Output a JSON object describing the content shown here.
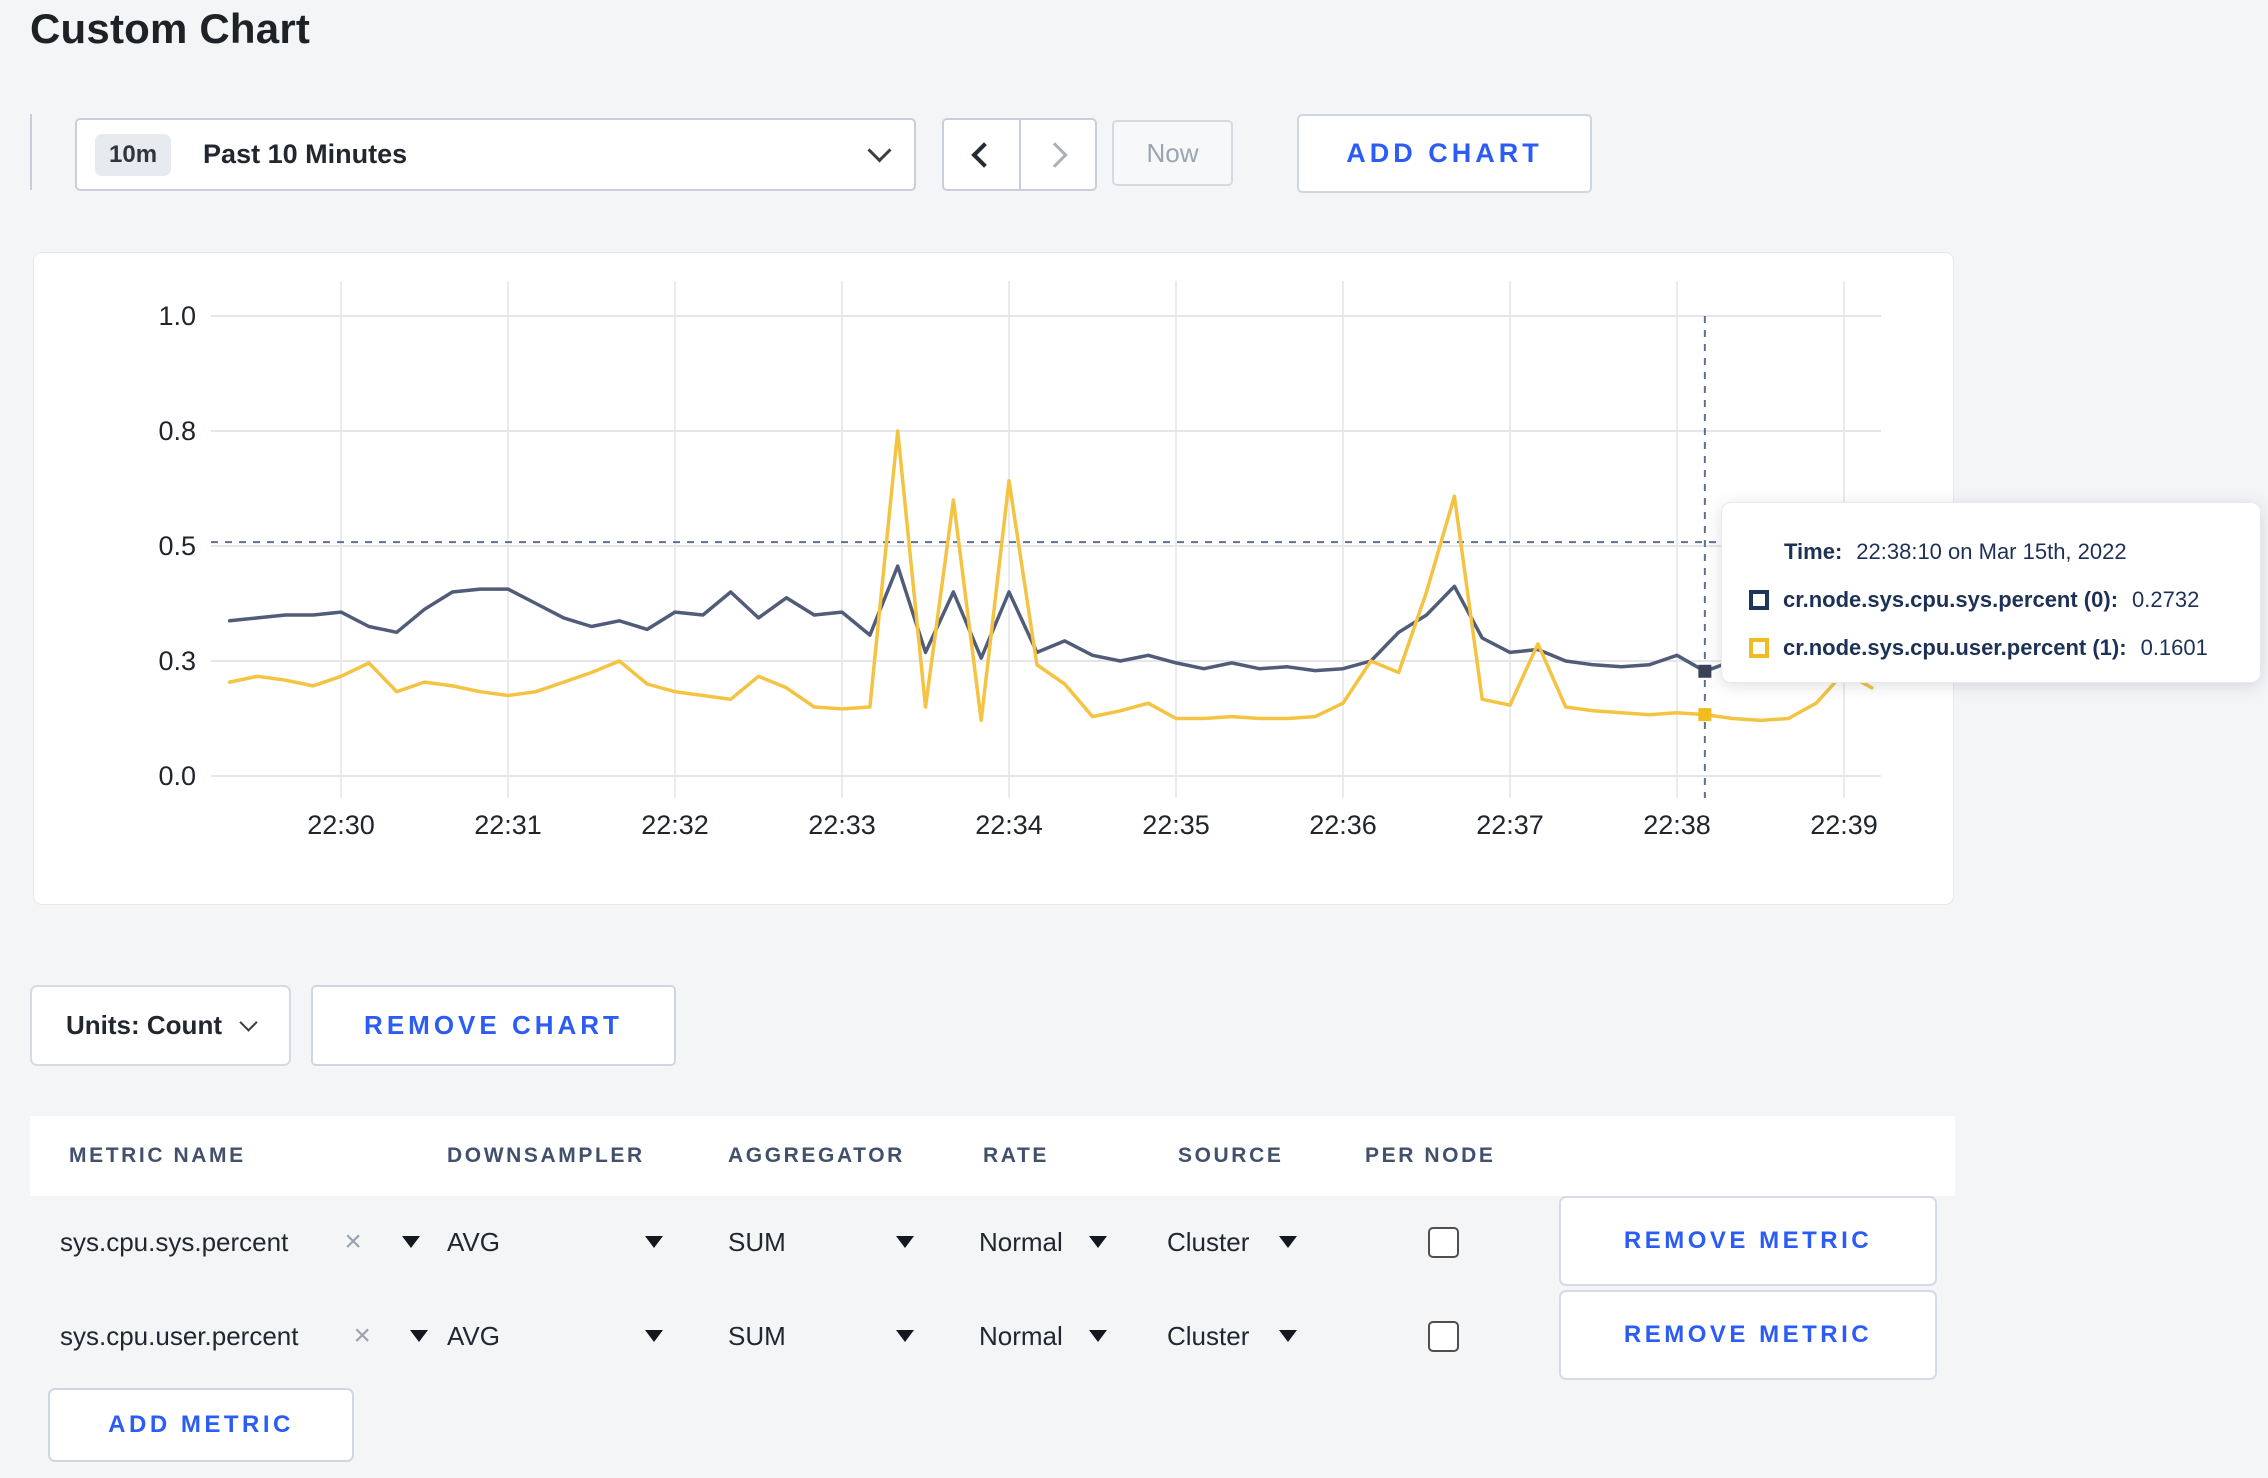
{
  "theme": {
    "accent_blue": "#2B5CF6",
    "panel_bg": "#FFFFFF",
    "page_bg": "#F4F5F7"
  },
  "page": {
    "title": "Custom Chart"
  },
  "toolbar": {
    "time_range": {
      "badge": "10m",
      "label": "Past 10 Minutes"
    },
    "now_label": "Now",
    "add_chart_label": "ADD CHART"
  },
  "chart_data": {
    "type": "line",
    "title": "",
    "xlabel": "",
    "ylabel": "",
    "ylim": [
      0.0,
      1.0
    ],
    "grid": true,
    "y_ticks": [
      0.0,
      0.3,
      0.5,
      0.8,
      1.0
    ],
    "y_tick_labels": [
      "0.0",
      "0.3",
      "0.5",
      "0.8",
      "1.0"
    ],
    "x_ticks": [
      "22:30",
      "22:31",
      "22:32",
      "22:33",
      "22:34",
      "22:35",
      "22:36",
      "22:37",
      "22:38",
      "22:39"
    ],
    "x_start": "22:29:20",
    "x_interval_seconds": 10,
    "series": [
      {
        "name": "cr.node.sys.cpu.sys.percent",
        "color": "#505C78",
        "marker_color": "#3A4357",
        "values": [
          0.37,
          0.375,
          0.38,
          0.38,
          0.385,
          0.36,
          0.35,
          0.39,
          0.42,
          0.425,
          0.425,
          0.4,
          0.375,
          0.36,
          0.37,
          0.355,
          0.385,
          0.38,
          0.42,
          0.375,
          0.41,
          0.38,
          0.385,
          0.345,
          0.465,
          0.315,
          0.42,
          0.305,
          0.42,
          0.315,
          0.335,
          0.31,
          0.3,
          0.31,
          0.295,
          0.28,
          0.295,
          0.28,
          0.285,
          0.275,
          0.28,
          0.3,
          0.35,
          0.38,
          0.43,
          0.34,
          0.315,
          0.32,
          0.3,
          0.29,
          0.285,
          0.29,
          0.31,
          0.2732,
          0.3,
          0.305,
          0.3,
          0.31,
          0.3,
          0.31
        ]
      },
      {
        "name": "cr.node.sys.cpu.user.percent",
        "color": "#F5C342",
        "marker_color": "#F2BB20",
        "values": [
          0.245,
          0.26,
          0.25,
          0.235,
          0.26,
          0.295,
          0.22,
          0.245,
          0.235,
          0.22,
          0.21,
          0.22,
          0.245,
          0.27,
          0.3,
          0.24,
          0.22,
          0.21,
          0.2,
          0.26,
          0.23,
          0.18,
          0.175,
          0.18,
          0.8,
          0.18,
          0.62,
          0.145,
          0.67,
          0.29,
          0.24,
          0.155,
          0.17,
          0.19,
          0.15,
          0.15,
          0.155,
          0.15,
          0.15,
          0.155,
          0.19,
          0.3,
          0.27,
          0.42,
          0.63,
          0.2,
          0.185,
          0.33,
          0.18,
          0.17,
          0.165,
          0.16,
          0.165,
          0.1601,
          0.15,
          0.145,
          0.15,
          0.19,
          0.27,
          0.23
        ]
      }
    ],
    "crosshair": {
      "x_time": "22:38:10",
      "x_index": 53,
      "y_value": 0.51
    },
    "legend_position": "none"
  },
  "tooltip": {
    "time_label": "Time:",
    "time_value": "22:38:10 on Mar 15th, 2022",
    "series": [
      {
        "label": "cr.node.sys.cpu.sys.percent (0):",
        "value": "0.2732",
        "swatch": "#21355B"
      },
      {
        "label": "cr.node.sys.cpu.user.percent (1):",
        "value": "0.1601",
        "swatch": "#F2BB20"
      }
    ]
  },
  "chart_footer": {
    "units_label": "Units: Count",
    "remove_chart_label": "REMOVE CHART"
  },
  "metrics_table": {
    "headers": [
      "METRIC NAME",
      "DOWNSAMPLER",
      "AGGREGATOR",
      "RATE",
      "SOURCE",
      "PER NODE"
    ],
    "rows": [
      {
        "metric": "sys.cpu.sys.percent",
        "downsampler": "AVG",
        "aggregator": "SUM",
        "rate": "Normal",
        "source": "Cluster",
        "per_node_checked": false,
        "remove_label": "REMOVE METRIC"
      },
      {
        "metric": "sys.cpu.user.percent",
        "downsampler": "AVG",
        "aggregator": "SUM",
        "rate": "Normal",
        "source": "Cluster",
        "per_node_checked": false,
        "remove_label": "REMOVE METRIC"
      }
    ],
    "add_metric_label": "ADD METRIC"
  }
}
